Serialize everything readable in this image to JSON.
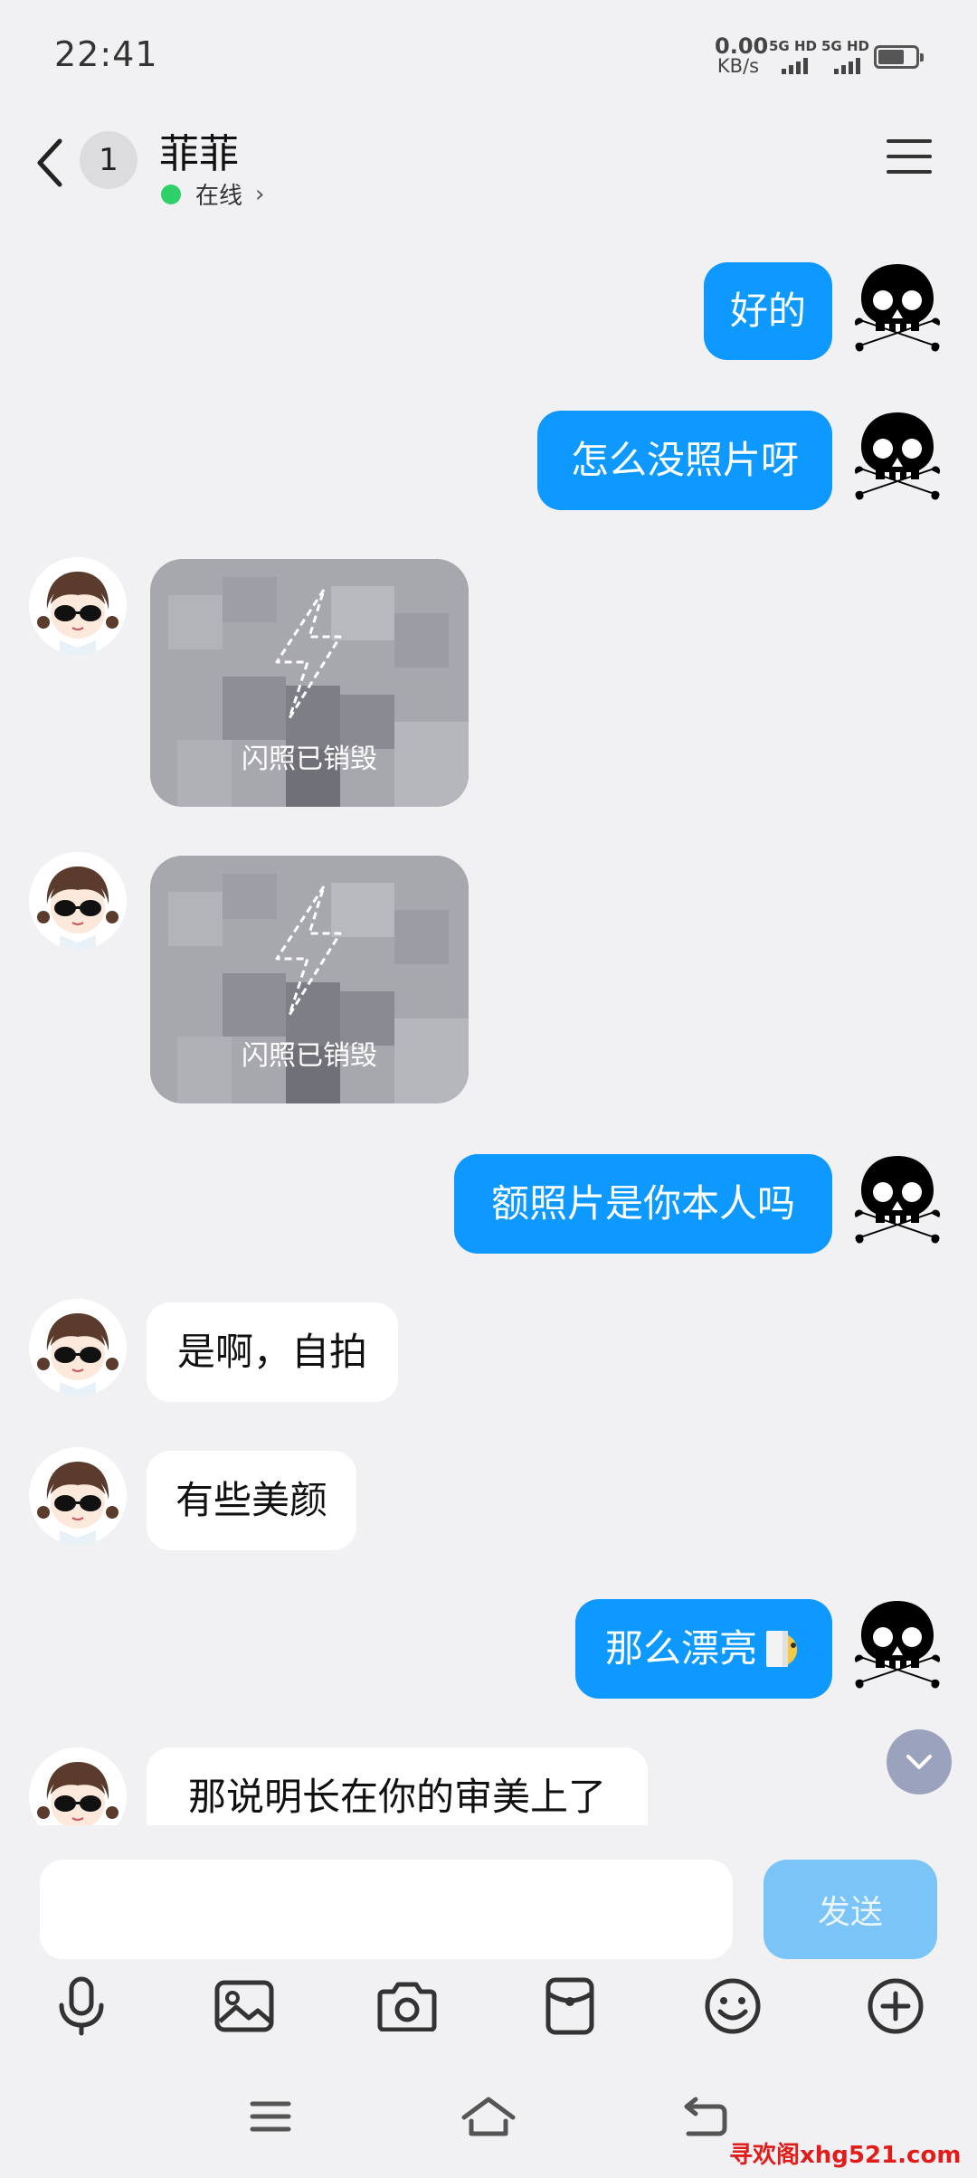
{
  "status_bar": {
    "time": "22:41",
    "net_speed_value": "0.00",
    "net_speed_unit": "KB/s",
    "sim1_label": "5G HD",
    "sim2_label": "5G HD"
  },
  "header": {
    "unread_count": "1",
    "contact_name": "菲菲",
    "presence": "在线",
    "presence_color": "#2ed06a"
  },
  "messages": [
    {
      "side": "out",
      "text": "好的"
    },
    {
      "side": "out",
      "text": "怎么没照片呀"
    },
    {
      "side": "in",
      "type": "flash_photo",
      "text": "闪照已销毁"
    },
    {
      "side": "in",
      "type": "flash_photo",
      "text": "闪照已销毁"
    },
    {
      "side": "out",
      "text": "额照片是你本人吗"
    },
    {
      "side": "in",
      "text": "是啊，自拍"
    },
    {
      "side": "in",
      "text": "有些美颜"
    },
    {
      "side": "out",
      "text": "那么漂亮",
      "emoji": "peeking-face"
    },
    {
      "side": "in",
      "text": "那说明长在你的审美上了"
    }
  ],
  "composer": {
    "input_value": "",
    "send_label": "发送"
  },
  "toolbar": [
    "microphone-icon",
    "image-icon",
    "camera-icon",
    "red-packet-icon",
    "emoji-icon",
    "plus-icon"
  ],
  "colors": {
    "outgoing_bubble": "#0d99ff",
    "incoming_bubble": "#ffffff",
    "background": "#f1f1f3",
    "send_button": "#7ac4f7"
  },
  "watermark": "寻欢阁xhg521.com"
}
